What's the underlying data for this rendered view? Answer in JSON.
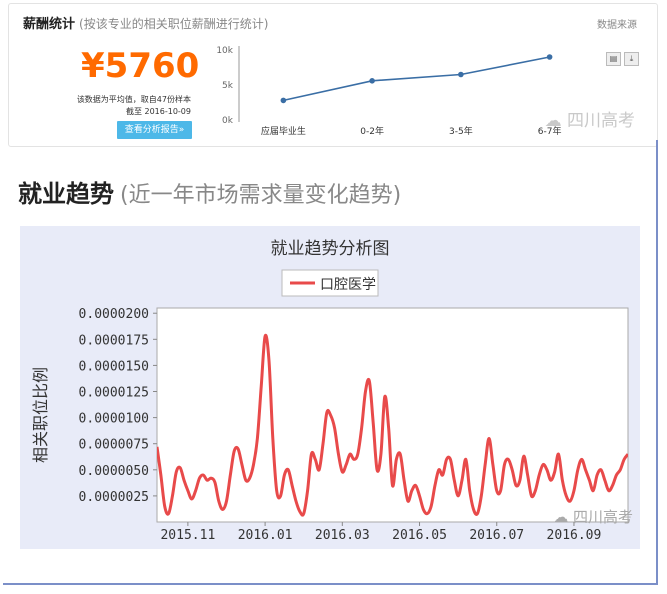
{
  "salary": {
    "title": "薪酬统计",
    "subtitle": "(按该专业的相关职位薪酬进行统计)",
    "data_source": "数据来源",
    "value": "¥5760",
    "note": "该数据为平均值，取自47份样本",
    "date": "截至 2016-10-09",
    "report_button": "查看分析报告»"
  },
  "watermark_small": "四川高考",
  "watermark_bottom": "四川高考",
  "employ": {
    "heading": "就业趋势",
    "subheading": "(近一年市场需求量变化趋势)"
  },
  "chart_data": [
    {
      "type": "line",
      "categories": [
        "应届毕业生",
        "0-2年",
        "3-5年",
        "6-7年"
      ],
      "values": [
        2800,
        5600,
        6500,
        9000
      ],
      "y_ticks": [
        "0k",
        "5k",
        "10k"
      ],
      "ylim": [
        0,
        10000
      ],
      "line_color": "#3a6ea5",
      "grid": false
    },
    {
      "type": "line",
      "title": "就业趋势分析图",
      "ylabel": "相关职位比例",
      "series": [
        {
          "name": "口腔医学",
          "color": "#e84a4a",
          "x": [
            0,
            1,
            2,
            3,
            4,
            5,
            6,
            7,
            8,
            9,
            10,
            11,
            12,
            13,
            14,
            15,
            16,
            17,
            18,
            19,
            20,
            21,
            22,
            23,
            24,
            25,
            26,
            27,
            28,
            29,
            30,
            31,
            32,
            33,
            34,
            35,
            36,
            37,
            38,
            39,
            40,
            41,
            42,
            43,
            44,
            45,
            46,
            47,
            48,
            49,
            50,
            51,
            52,
            53,
            54,
            55,
            56,
            57,
            58,
            59,
            60,
            61,
            62,
            63,
            64,
            65,
            66,
            67,
            68,
            69,
            70,
            71,
            72,
            73,
            74,
            75,
            76,
            77,
            78,
            79,
            80,
            81,
            82,
            83,
            84,
            85,
            86,
            87,
            88,
            89,
            90,
            91,
            92,
            93,
            94,
            95,
            96,
            97,
            98,
            99,
            100,
            101,
            102,
            103,
            104,
            105,
            106,
            107,
            108,
            109,
            110,
            111,
            112,
            113,
            114,
            115,
            116,
            117,
            118,
            119,
            120,
            121,
            122
          ],
          "values": [
            7.2e-06,
            4.5e-06,
            1.5e-06,
            8e-07,
            2.5e-06,
            4.8e-06,
            5.2e-06,
            4e-06,
            3e-06,
            2.2e-06,
            3e-06,
            4.2e-06,
            4.5e-06,
            4e-06,
            4.2e-06,
            3.8e-06,
            2e-06,
            1.2e-06,
            2e-06,
            4.5e-06,
            6.8e-06,
            7e-06,
            5.5e-06,
            4e-06,
            4.2e-06,
            5.5e-06,
            8e-06,
            1.3e-05,
            1.78e-05,
            1.55e-05,
            8e-06,
            3e-06,
            2.5e-06,
            4.5e-06,
            5e-06,
            3.5e-06,
            2e-06,
            1e-06,
            8e-07,
            3e-06,
            6.5e-06,
            6e-06,
            5e-06,
            7.5e-06,
            1.05e-05,
            1.02e-05,
            9e-06,
            6.5e-06,
            4.8e-06,
            5.5e-06,
            6.5e-06,
            6e-06,
            6.5e-06,
            9e-06,
            1.25e-05,
            1.35e-05,
            9.5e-06,
            5e-06,
            6.5e-06,
            1.2e-05,
            9e-06,
            3.5e-06,
            6e-06,
            6.5e-06,
            4e-06,
            2e-06,
            3e-06,
            3.5e-06,
            2.5e-06,
            1.2e-06,
            8e-07,
            1.5e-06,
            3.5e-06,
            5e-06,
            4.5e-06,
            6e-06,
            6e-06,
            4e-06,
            2.5e-06,
            4e-06,
            6e-06,
            3e-06,
            1.2e-06,
            8e-07,
            2.5e-06,
            5.5e-06,
            8e-06,
            5.5e-06,
            3e-06,
            3e-06,
            5.5e-06,
            6e-06,
            5e-06,
            3.5e-06,
            4e-06,
            6.3e-06,
            4.5e-06,
            2.5e-06,
            3e-06,
            4.5e-06,
            5.5e-06,
            5e-06,
            4e-06,
            4.8e-06,
            6.5e-06,
            4e-06,
            2.5e-06,
            2e-06,
            3e-06,
            5e-06,
            6e-06,
            5e-06,
            4e-06,
            3e-06,
            4.5e-06,
            5e-06,
            4e-06,
            3e-06,
            3.5e-06,
            4.5e-06,
            5e-06,
            6e-06,
            6.5e-06
          ]
        }
      ],
      "x_tick_labels": [
        "2015.11",
        "2016.01",
        "2016.03",
        "2016.05",
        "2016.07",
        "2016.09"
      ],
      "y_tick_labels": [
        "0.0000025",
        "0.0000050",
        "0.0000075",
        "0.0000100",
        "0.0000125",
        "0.0000150",
        "0.0000175",
        "0.0000200"
      ],
      "ylim": [
        0,
        2.05e-05
      ],
      "grid": false,
      "legend_position": "top-center"
    }
  ]
}
